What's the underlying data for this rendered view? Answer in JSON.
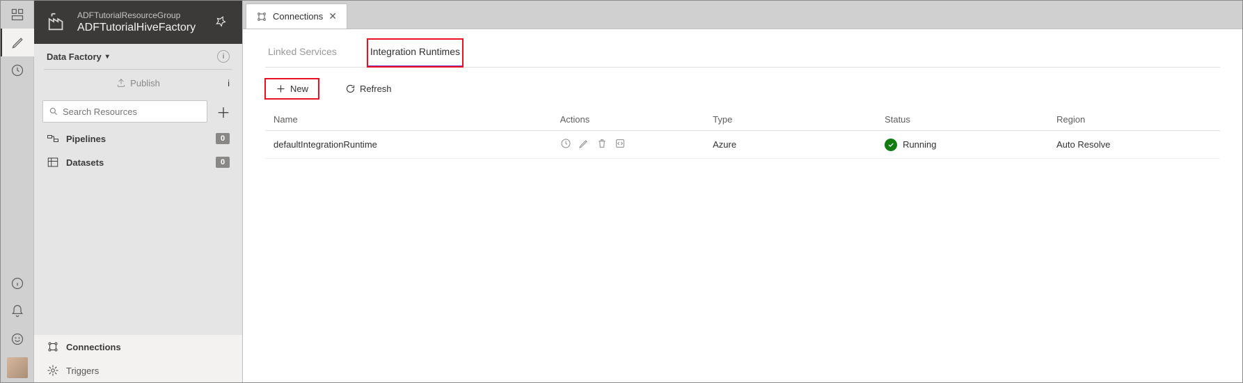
{
  "header": {
    "resource_group": "ADFTutorialResourceGroup",
    "factory_name": "ADFTutorialHiveFactory"
  },
  "sidebar": {
    "root_label": "Data Factory",
    "publish_label": "Publish",
    "search_placeholder": "Search Resources",
    "items": [
      {
        "label": "Pipelines",
        "count": "0"
      },
      {
        "label": "Datasets",
        "count": "0"
      }
    ],
    "bottom": [
      {
        "label": "Connections"
      },
      {
        "label": "Triggers"
      }
    ]
  },
  "tab": {
    "title": "Connections"
  },
  "subtabs": {
    "linked": "Linked Services",
    "ir": "Integration Runtimes"
  },
  "toolbar": {
    "new_label": "New",
    "refresh_label": "Refresh"
  },
  "table": {
    "headers": {
      "name": "Name",
      "actions": "Actions",
      "type": "Type",
      "status": "Status",
      "region": "Region"
    },
    "rows": [
      {
        "name": "defaultIntegrationRuntime",
        "type": "Azure",
        "status": "Running",
        "region": "Auto Resolve"
      }
    ]
  }
}
